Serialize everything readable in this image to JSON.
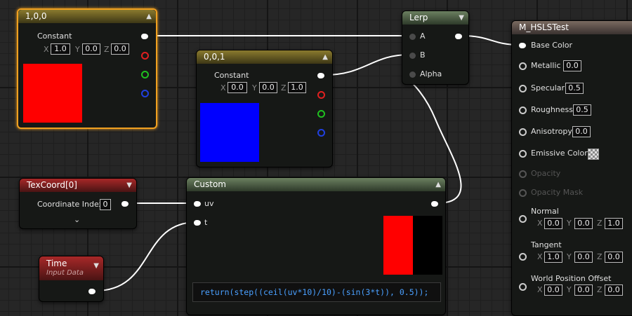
{
  "colors": {
    "red": "#ff0000",
    "blue": "#0000ff",
    "black": "#000000",
    "selection": "#f0a020"
  },
  "node_const_100": {
    "title": "1,0,0",
    "output_label": "Constant",
    "x_label": "X",
    "x": "1.0",
    "y_label": "Y",
    "y": "0.0",
    "z_label": "Z",
    "z": "0.0"
  },
  "node_const_001": {
    "title": "0,0,1",
    "output_label": "Constant",
    "x_label": "X",
    "x": "0.0",
    "y_label": "Y",
    "y": "0.0",
    "z_label": "Z",
    "z": "1.0"
  },
  "node_lerp": {
    "title": "Lerp",
    "pin_a": "A",
    "pin_b": "B",
    "pin_alpha": "Alpha"
  },
  "node_texcoord": {
    "title": "TexCoord[0]",
    "coord_label": "Coordinate Index",
    "coord_value": "0"
  },
  "node_time": {
    "title": "Time",
    "subtitle": "Input Data"
  },
  "node_custom": {
    "title": "Custom",
    "pin_uv": "uv",
    "pin_t": "t",
    "code": "return(step((ceil(uv*10)/10)-(sin(3*t)), 0.5));"
  },
  "material": {
    "title": "M_HSLSTest",
    "base_color": "Base Color",
    "metallic": "Metallic",
    "metallic_value": "0.0",
    "specular": "Specular",
    "specular_value": "0.5",
    "roughness": "Roughness",
    "roughness_value": "0.5",
    "anisotropy": "Anisotropy",
    "anisotropy_value": "0.0",
    "emissive": "Emissive Color",
    "opacity": "Opacity",
    "opacity_mask": "Opacity Mask",
    "normal": "Normal",
    "normal_x": "0.0",
    "normal_y": "0.0",
    "normal_z": "1.0",
    "tangent": "Tangent",
    "tangent_x": "1.0",
    "tangent_y": "0.0",
    "tangent_z": "0.0",
    "wpo": "World Position Offset",
    "wpo_x": "0.0",
    "wpo_y": "0.0",
    "wpo_z": "0.0",
    "axis_x": "X",
    "axis_y": "Y",
    "axis_z": "Z"
  },
  "icons": {
    "collapse": "chevron-up-icon",
    "expand": "chevron-down-icon",
    "emissive": "checker-icon"
  }
}
